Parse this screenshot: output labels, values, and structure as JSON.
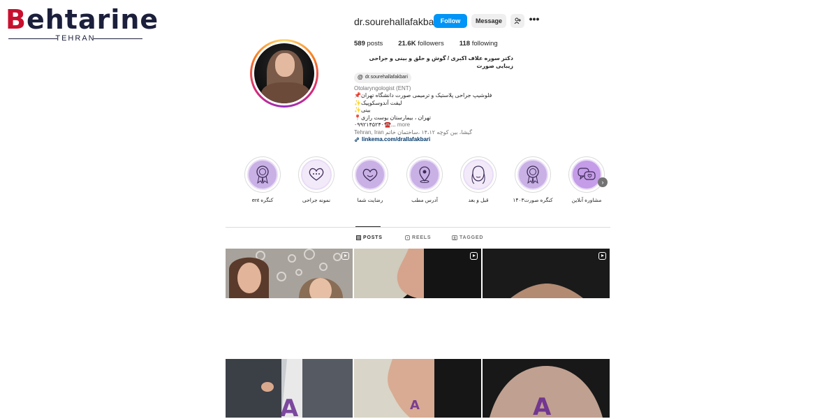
{
  "watermark": {
    "brand": "Behtarine",
    "sub": "TEHRAN"
  },
  "profile": {
    "username": "dr.sourehallafakbari",
    "follow_label": "Follow",
    "message_label": "Message",
    "stats": {
      "posts": "589",
      "posts_label": "posts",
      "followers": "21.6K",
      "followers_label": "followers",
      "following": "118",
      "following_label": "following"
    },
    "display_name": "دکتر سوره علاف اکبری / گوش و حلق و بینی و جراحی زیبایی صورت",
    "threads_handle": "dr.sourehallafakbari",
    "category": "Otolaryngologist (ENT)",
    "bio_lines": [
      "فلوشیپ جراحی پلاستیک و ترمیمی صورت دانشگاه تهران📌",
      "لیفت آندوسکوپیک✨",
      "بینی✨",
      "تهران ، بیمارستان یوست رازی📍"
    ],
    "phone_line": "۰۹۹۲۱۴۵۲۴۰☎️...",
    "more_label": "more",
    "location_line": "Tehran, Iran گیشا، بین کوچه ۱۴،۱۲ ،ساختمان خاتم",
    "link": "linkema.com/drallafakbari"
  },
  "highlights": [
    {
      "label": "کنگره ent",
      "icon": "medal-icon"
    },
    {
      "label": "نمونه جراحی",
      "icon": "hearts-chat-icon"
    },
    {
      "label": "رضایت شما",
      "icon": "heart-face-icon"
    },
    {
      "label": "آدرس مطب",
      "icon": "location-pin-icon"
    },
    {
      "label": "قبل و بعد",
      "icon": "face-outline-icon"
    },
    {
      "label": "کنگره صورت۱۴۰۳",
      "icon": "medal-icon"
    },
    {
      "label": "مشاوره آنلاین",
      "icon": "chat-bubbles-icon"
    }
  ],
  "tabs": {
    "posts": "POSTS",
    "reels": "REELS",
    "tagged": "TAGGED"
  },
  "colors": {
    "primary_button": "#0095f6",
    "highlight_fill": "#c9b1e6",
    "link": "#00376b"
  }
}
